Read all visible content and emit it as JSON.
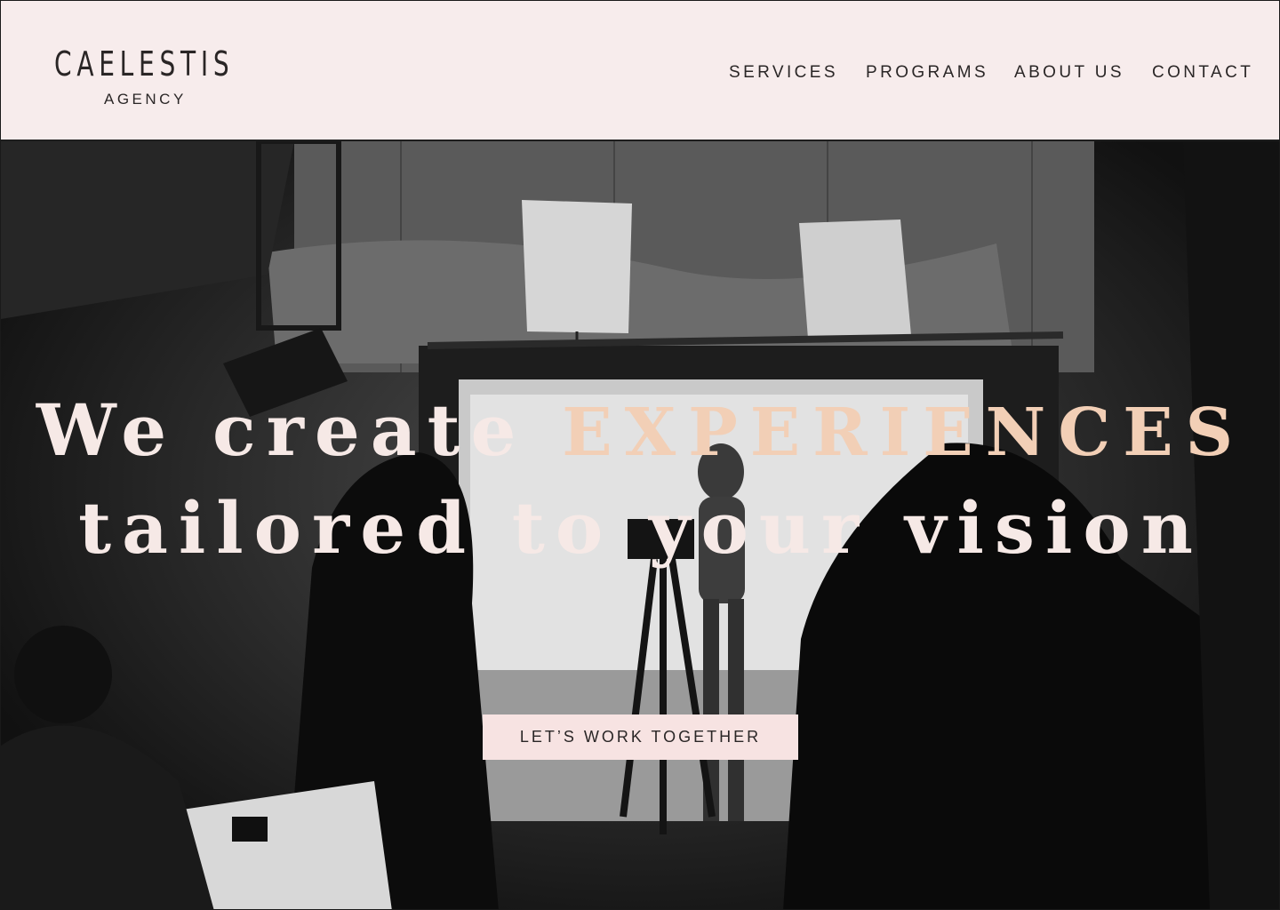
{
  "brand": {
    "name": "CAELESTIS",
    "tagline": "AGENCY"
  },
  "nav": {
    "items": [
      {
        "label": "SERVICES"
      },
      {
        "label": "PROGRAMS"
      },
      {
        "label": "ABOUT US"
      },
      {
        "label": "CONTACT"
      }
    ]
  },
  "hero": {
    "headline_line1_prefix": "We create",
    "headline_line1_accent": "EXPERIENCES",
    "headline_line2": "tailored to your vision",
    "cta_label": "LET’S WORK TOGETHER",
    "image_icon": "photo-studio-scene"
  },
  "colors": {
    "header_bg": "#f7ecec",
    "text_dark": "#2a2626",
    "accent_peach": "#f2cfb6",
    "headline_light": "#f6e9e6",
    "cta_bg": "#f7e3e2"
  }
}
